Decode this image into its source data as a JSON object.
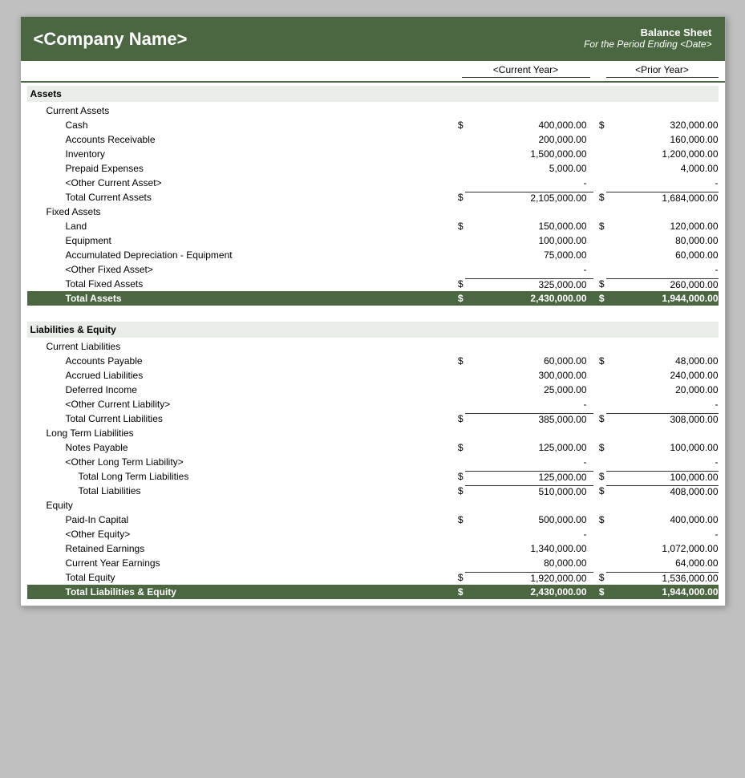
{
  "header": {
    "company_name": "<Company Name>",
    "sheet_title": "Balance Sheet",
    "sheet_period": "For the Period Ending <Date>"
  },
  "columns": {
    "current_year": "<Current Year>",
    "prior_year": "<Prior Year>"
  },
  "assets": {
    "label": "Assets",
    "current_assets": {
      "label": "Current Assets",
      "items": [
        {
          "label": "Cash",
          "cy": "400,000.00",
          "py": "320,000.00",
          "dollar": "$"
        },
        {
          "label": "Accounts Receivable",
          "cy": "200,000.00",
          "py": "160,000.00",
          "dollar": ""
        },
        {
          "label": "Inventory",
          "cy": "1,500,000.00",
          "py": "1,200,000.00",
          "dollar": ""
        },
        {
          "label": "Prepaid Expenses",
          "cy": "5,000.00",
          "py": "4,000.00",
          "dollar": ""
        },
        {
          "label": "<Other Current Asset>",
          "cy": "-",
          "py": "-",
          "dollar": ""
        }
      ],
      "total_label": "Total Current Assets",
      "total_cy": "2,105,000.00",
      "total_py": "1,684,000.00"
    },
    "fixed_assets": {
      "label": "Fixed Assets",
      "items": [
        {
          "label": "Land",
          "cy": "150,000.00",
          "py": "120,000.00",
          "dollar": "$"
        },
        {
          "label": "Equipment",
          "cy": "100,000.00",
          "py": "80,000.00",
          "dollar": ""
        },
        {
          "label": "Accumulated Depreciation - Equipment",
          "cy": "75,000.00",
          "py": "60,000.00",
          "dollar": ""
        },
        {
          "label": "<Other Fixed Asset>",
          "cy": "-",
          "py": "-",
          "dollar": ""
        }
      ],
      "total_label": "Total Fixed Assets",
      "total_cy": "325,000.00",
      "total_py": "260,000.00"
    },
    "total_label": "Total Assets",
    "total_cy": "2,430,000.00",
    "total_py": "1,944,000.00"
  },
  "liabilities_equity": {
    "label": "Liabilities & Equity",
    "current_liabilities": {
      "label": "Current Liabilities",
      "items": [
        {
          "label": "Accounts Payable",
          "cy": "60,000.00",
          "py": "48,000.00",
          "dollar": "$"
        },
        {
          "label": "Accrued Liabilities",
          "cy": "300,000.00",
          "py": "240,000.00",
          "dollar": ""
        },
        {
          "label": "Deferred Income",
          "cy": "25,000.00",
          "py": "20,000.00",
          "dollar": ""
        },
        {
          "label": "<Other Current Liability>",
          "cy": "-",
          "py": "-",
          "dollar": ""
        }
      ],
      "total_label": "Total Current Liabilities",
      "total_cy": "385,000.00",
      "total_py": "308,000.00"
    },
    "long_term_liabilities": {
      "label": "Long Term Liabilities",
      "items": [
        {
          "label": "Notes Payable",
          "cy": "125,000.00",
          "py": "100,000.00",
          "dollar": "$"
        },
        {
          "label": "<Other Long Term Liability>",
          "cy": "-",
          "py": "-",
          "dollar": ""
        }
      ],
      "total_long_term_label": "Total Long Term Liabilities",
      "total_long_term_cy": "125,000.00",
      "total_long_term_py": "100,000.00",
      "total_liabilities_label": "Total Liabilities",
      "total_liabilities_cy": "510,000.00",
      "total_liabilities_py": "408,000.00"
    },
    "equity": {
      "label": "Equity",
      "items": [
        {
          "label": "Paid-In Capital",
          "cy": "500,000.00",
          "py": "400,000.00",
          "dollar": "$"
        },
        {
          "label": "<Other Equity>",
          "cy": "-",
          "py": "-",
          "dollar": ""
        },
        {
          "label": "Retained Earnings",
          "cy": "1,340,000.00",
          "py": "1,072,000.00",
          "dollar": ""
        },
        {
          "label": "Current Year Earnings",
          "cy": "80,000.00",
          "py": "64,000.00",
          "dollar": ""
        }
      ],
      "total_label": "Total Equity",
      "total_cy": "1,920,000.00",
      "total_py": "1,536,000.00"
    },
    "total_label": "Total Liabilities & Equity",
    "total_cy": "2,430,000.00",
    "total_py": "1,944,000.00"
  }
}
